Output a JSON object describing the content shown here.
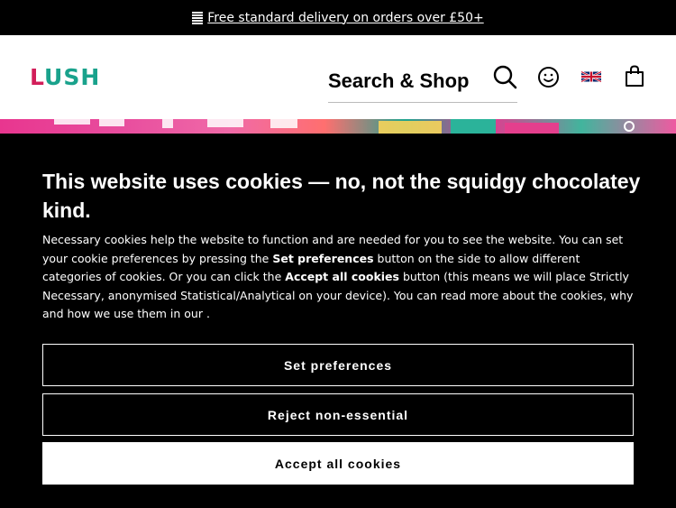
{
  "announcement": {
    "icon": "truck-icon",
    "link_text": "Free standard delivery on orders over £50+"
  },
  "header": {
    "logo_first": "L",
    "logo_rest": "USH",
    "search_label": "Search & Shop",
    "icons": [
      "search-icon",
      "account-smiley-icon",
      "uk-flag-icon",
      "shopping-bag-icon"
    ]
  },
  "cookie_banner": {
    "title": "This website uses cookies — no, not the squidgy chocolatey kind.",
    "body_1": "Necessary cookies help the website to function and are needed for you to see the website. You can set your cookie preferences by pressing the ",
    "body_b1": "Set preferences",
    "body_2": " button on the side to allow different categories of cookies. Or you can click the ",
    "body_b2": "Accept all cookies",
    "body_3": " button (this means we will place Strictly Necessary, anonymised Statistical/Analytical on your device). You can read more about the cookies, why and how we use them in our .",
    "set_preferences": "Set preferences",
    "reject": "Reject non-essential",
    "accept": "Accept all cookies"
  },
  "colors": {
    "logo_pink": "#d21e5a",
    "logo_green": "#19a28c",
    "background": "#000000"
  }
}
